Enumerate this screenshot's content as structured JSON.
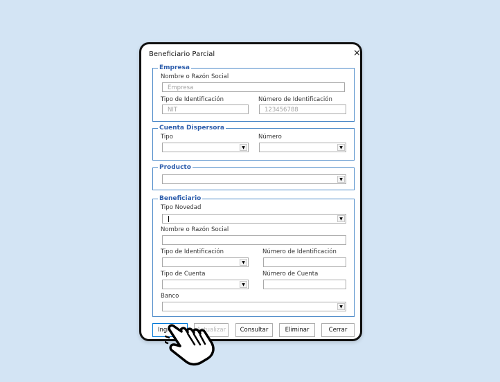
{
  "window": {
    "title": "Beneficiario Parcial",
    "close_glyph": "✕"
  },
  "empresa": {
    "legend": "Empresa",
    "nombre_label": "Nombre o Razón Social",
    "nombre_value": "Empresa",
    "tipo_id_label": "Tipo de Identificación",
    "tipo_id_value": "NIT",
    "numero_id_label": "Número  de Identificación",
    "numero_id_value": "123456788"
  },
  "cuenta": {
    "legend": "Cuenta Dispersora",
    "tipo_label": "Tipo",
    "numero_label": "Número"
  },
  "producto": {
    "legend": "Producto"
  },
  "beneficiario": {
    "legend": "Beneficiario",
    "tipo_novedad_label": "Tipo Novedad",
    "nombre_label": "Nombre o Razón Social",
    "tipo_id_label": "Tipo de Identificación",
    "numero_id_label": "Número de Identificación",
    "tipo_cuenta_label": "Tipo de Cuenta",
    "numero_cuenta_label": "Número de Cuenta",
    "banco_label": "Banco"
  },
  "buttons": {
    "ingresar": "Ingresar",
    "actualizar": "Actualizar",
    "consultar": "Consultar",
    "eliminar": "Eliminar",
    "cerrar": "Cerrar"
  },
  "icons": {
    "dropdown": "chevron-down-icon",
    "pointer": "hand-pointer-icon"
  },
  "colors": {
    "background": "#d3e4f4",
    "frame_border": "#4b89c8",
    "legend_text": "#2f5fad"
  }
}
